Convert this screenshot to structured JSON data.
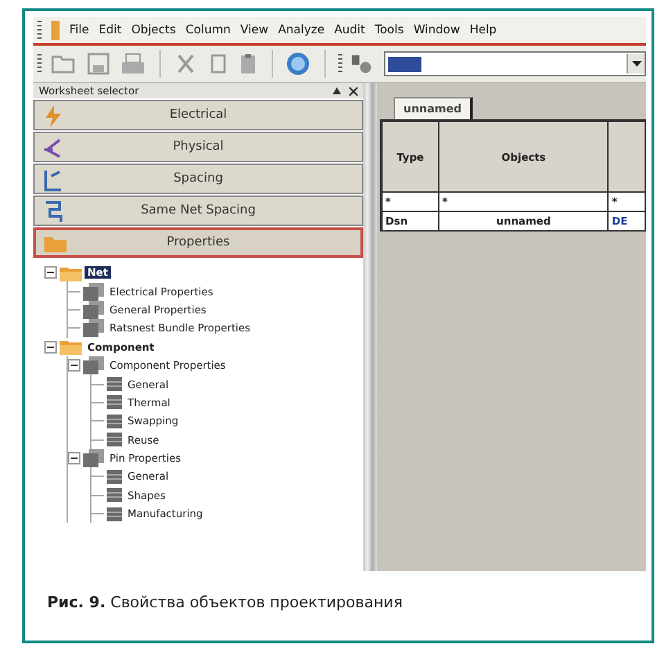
{
  "menu": [
    "File",
    "Edit",
    "Objects",
    "Column",
    "View",
    "Analyze",
    "Audit",
    "Tools",
    "Window",
    "Help"
  ],
  "worksheet_selector": {
    "title": "Worksheet selector",
    "buttons": [
      {
        "label": "Electrical",
        "selected": false,
        "kind": "electrical"
      },
      {
        "label": "Physical",
        "selected": false,
        "kind": "physical"
      },
      {
        "label": "Spacing",
        "selected": false,
        "kind": "spacing"
      },
      {
        "label": "Same Net Spacing",
        "selected": false,
        "kind": "samenet"
      },
      {
        "label": "Properties",
        "selected": true,
        "kind": "properties"
      }
    ]
  },
  "tree": [
    {
      "label": "Net",
      "kind": "folder",
      "expanded": true,
      "selected": true,
      "children": [
        {
          "label": "Electrical Properties",
          "kind": "group",
          "selected": false
        },
        {
          "label": "General Properties",
          "kind": "group",
          "selected": false
        },
        {
          "label": "Ratsnest Bundle Properties",
          "kind": "group",
          "selected": false
        }
      ]
    },
    {
      "label": "Component",
      "kind": "folder",
      "expanded": true,
      "selected": false,
      "children": [
        {
          "label": "Component Properties",
          "kind": "group",
          "expanded": true,
          "selected": false,
          "children": [
            {
              "label": "General",
              "kind": "sheet",
              "selected": false
            },
            {
              "label": "Thermal",
              "kind": "sheet",
              "selected": false
            },
            {
              "label": "Swapping",
              "kind": "sheet",
              "selected": false
            },
            {
              "label": "Reuse",
              "kind": "sheet",
              "selected": false
            }
          ]
        },
        {
          "label": "Pin Properties",
          "kind": "group",
          "expanded": true,
          "selected": false,
          "children": [
            {
              "label": "General",
              "kind": "sheet",
              "selected": false
            },
            {
              "label": "Shapes",
              "kind": "sheet",
              "selected": false
            },
            {
              "label": "Manufacturing",
              "kind": "sheet",
              "selected": false
            }
          ]
        }
      ]
    }
  ],
  "tabs": [
    {
      "label": "unnamed",
      "selected": true
    }
  ],
  "table": {
    "columns": [
      "Type",
      "Objects"
    ],
    "rows": [
      [
        "*",
        "*",
        "*"
      ],
      [
        "Dsn",
        "unnamed",
        "DE"
      ]
    ]
  },
  "caption": "**Рис. 9.** Свойства объектов проектирования"
}
